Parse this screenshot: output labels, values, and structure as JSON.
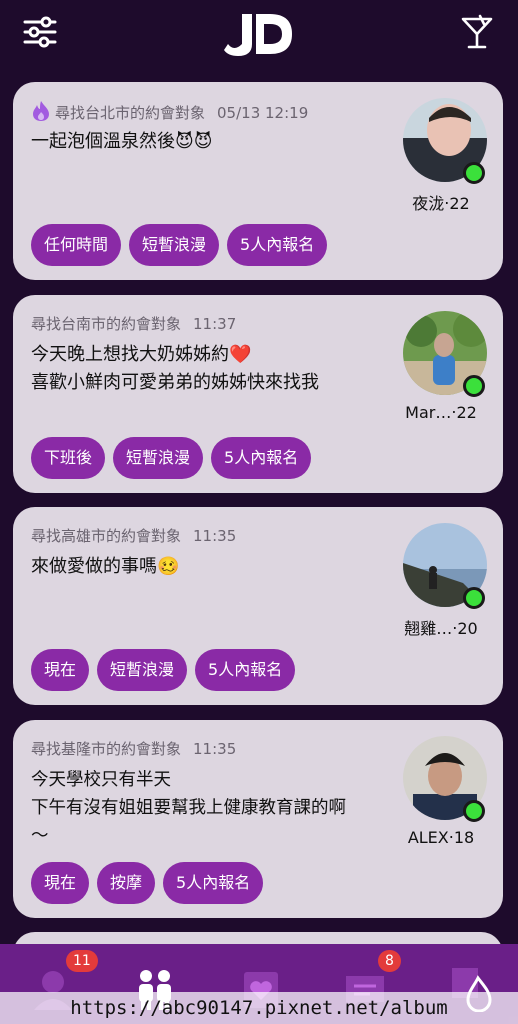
{
  "header": {
    "filter_icon": "sliders-icon",
    "logo_text": "JD",
    "right_icon": "cocktail-glass-icon"
  },
  "cards": [
    {
      "location": "尋找台北市的約會對象",
      "time": "05/13 12:19",
      "message": "一起泡個溫泉然後😈😈",
      "username": "夜泷‧22",
      "tags": [
        "任何時間",
        "短暫浪漫",
        "5人內報名"
      ],
      "hot": true
    },
    {
      "location": "尋找台南市的約會對象",
      "time": "11:37",
      "message": "今天晚上想找大奶姊姊約❤️\n喜歡小鮮肉可愛弟弟的姊姊快來找我",
      "username": "Mar…‧22",
      "tags": [
        "下班後",
        "短暫浪漫",
        "5人內報名"
      ]
    },
    {
      "location": "尋找高雄市的約會對象",
      "time": "11:35",
      "message": "來做愛做的事嗎🥴",
      "username": "翹雞…‧20",
      "tags": [
        "現在",
        "短暫浪漫",
        "5人內報名"
      ]
    },
    {
      "location": "尋找基隆市的約會對象",
      "time": "11:35",
      "message": "今天學校只有半天\n下午有沒有姐姐要幫我上健康教育課的啊\n～",
      "username": "ALEX‧18",
      "tags": [
        "現在",
        "按摩",
        "5人內報名"
      ]
    }
  ],
  "nav": {
    "items": [
      {
        "name": "profile-icon",
        "badge": "11"
      },
      {
        "name": "people-icon",
        "badge": ""
      },
      {
        "name": "heart-card-icon",
        "badge": ""
      },
      {
        "name": "chat-icon",
        "badge": "8"
      },
      {
        "name": "drop-icon",
        "badge": ""
      }
    ]
  },
  "watermark": "https://abc90147.pixnet.net/album",
  "colors": {
    "background": "#1e0b2c",
    "card": "#ddd6e0",
    "tag": "#8a2aa6",
    "nav": "#6a1f88",
    "online": "#3be03b",
    "badge": "#e33b3b"
  }
}
